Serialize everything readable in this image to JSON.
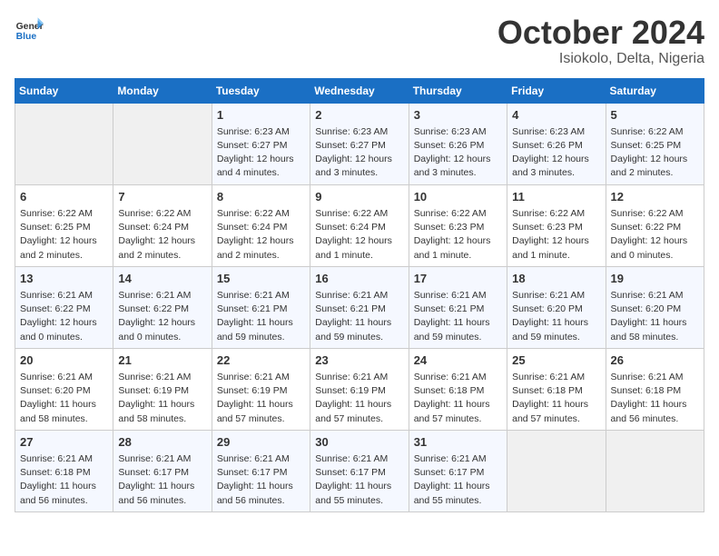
{
  "logo": {
    "line1": "General",
    "line2": "Blue"
  },
  "title": "October 2024",
  "subtitle": "Isiokolo, Delta, Nigeria",
  "weekdays": [
    "Sunday",
    "Monday",
    "Tuesday",
    "Wednesday",
    "Thursday",
    "Friday",
    "Saturday"
  ],
  "weeks": [
    [
      {
        "day": "",
        "info": ""
      },
      {
        "day": "",
        "info": ""
      },
      {
        "day": "1",
        "info": "Sunrise: 6:23 AM\nSunset: 6:27 PM\nDaylight: 12 hours and 4 minutes."
      },
      {
        "day": "2",
        "info": "Sunrise: 6:23 AM\nSunset: 6:27 PM\nDaylight: 12 hours and 3 minutes."
      },
      {
        "day": "3",
        "info": "Sunrise: 6:23 AM\nSunset: 6:26 PM\nDaylight: 12 hours and 3 minutes."
      },
      {
        "day": "4",
        "info": "Sunrise: 6:23 AM\nSunset: 6:26 PM\nDaylight: 12 hours and 3 minutes."
      },
      {
        "day": "5",
        "info": "Sunrise: 6:22 AM\nSunset: 6:25 PM\nDaylight: 12 hours and 2 minutes."
      }
    ],
    [
      {
        "day": "6",
        "info": "Sunrise: 6:22 AM\nSunset: 6:25 PM\nDaylight: 12 hours and 2 minutes."
      },
      {
        "day": "7",
        "info": "Sunrise: 6:22 AM\nSunset: 6:24 PM\nDaylight: 12 hours and 2 minutes."
      },
      {
        "day": "8",
        "info": "Sunrise: 6:22 AM\nSunset: 6:24 PM\nDaylight: 12 hours and 2 minutes."
      },
      {
        "day": "9",
        "info": "Sunrise: 6:22 AM\nSunset: 6:24 PM\nDaylight: 12 hours and 1 minute."
      },
      {
        "day": "10",
        "info": "Sunrise: 6:22 AM\nSunset: 6:23 PM\nDaylight: 12 hours and 1 minute."
      },
      {
        "day": "11",
        "info": "Sunrise: 6:22 AM\nSunset: 6:23 PM\nDaylight: 12 hours and 1 minute."
      },
      {
        "day": "12",
        "info": "Sunrise: 6:22 AM\nSunset: 6:22 PM\nDaylight: 12 hours and 0 minutes."
      }
    ],
    [
      {
        "day": "13",
        "info": "Sunrise: 6:21 AM\nSunset: 6:22 PM\nDaylight: 12 hours and 0 minutes."
      },
      {
        "day": "14",
        "info": "Sunrise: 6:21 AM\nSunset: 6:22 PM\nDaylight: 12 hours and 0 minutes."
      },
      {
        "day": "15",
        "info": "Sunrise: 6:21 AM\nSunset: 6:21 PM\nDaylight: 11 hours and 59 minutes."
      },
      {
        "day": "16",
        "info": "Sunrise: 6:21 AM\nSunset: 6:21 PM\nDaylight: 11 hours and 59 minutes."
      },
      {
        "day": "17",
        "info": "Sunrise: 6:21 AM\nSunset: 6:21 PM\nDaylight: 11 hours and 59 minutes."
      },
      {
        "day": "18",
        "info": "Sunrise: 6:21 AM\nSunset: 6:20 PM\nDaylight: 11 hours and 59 minutes."
      },
      {
        "day": "19",
        "info": "Sunrise: 6:21 AM\nSunset: 6:20 PM\nDaylight: 11 hours and 58 minutes."
      }
    ],
    [
      {
        "day": "20",
        "info": "Sunrise: 6:21 AM\nSunset: 6:20 PM\nDaylight: 11 hours and 58 minutes."
      },
      {
        "day": "21",
        "info": "Sunrise: 6:21 AM\nSunset: 6:19 PM\nDaylight: 11 hours and 58 minutes."
      },
      {
        "day": "22",
        "info": "Sunrise: 6:21 AM\nSunset: 6:19 PM\nDaylight: 11 hours and 57 minutes."
      },
      {
        "day": "23",
        "info": "Sunrise: 6:21 AM\nSunset: 6:19 PM\nDaylight: 11 hours and 57 minutes."
      },
      {
        "day": "24",
        "info": "Sunrise: 6:21 AM\nSunset: 6:18 PM\nDaylight: 11 hours and 57 minutes."
      },
      {
        "day": "25",
        "info": "Sunrise: 6:21 AM\nSunset: 6:18 PM\nDaylight: 11 hours and 57 minutes."
      },
      {
        "day": "26",
        "info": "Sunrise: 6:21 AM\nSunset: 6:18 PM\nDaylight: 11 hours and 56 minutes."
      }
    ],
    [
      {
        "day": "27",
        "info": "Sunrise: 6:21 AM\nSunset: 6:18 PM\nDaylight: 11 hours and 56 minutes."
      },
      {
        "day": "28",
        "info": "Sunrise: 6:21 AM\nSunset: 6:17 PM\nDaylight: 11 hours and 56 minutes."
      },
      {
        "day": "29",
        "info": "Sunrise: 6:21 AM\nSunset: 6:17 PM\nDaylight: 11 hours and 56 minutes."
      },
      {
        "day": "30",
        "info": "Sunrise: 6:21 AM\nSunset: 6:17 PM\nDaylight: 11 hours and 55 minutes."
      },
      {
        "day": "31",
        "info": "Sunrise: 6:21 AM\nSunset: 6:17 PM\nDaylight: 11 hours and 55 minutes."
      },
      {
        "day": "",
        "info": ""
      },
      {
        "day": "",
        "info": ""
      }
    ]
  ]
}
